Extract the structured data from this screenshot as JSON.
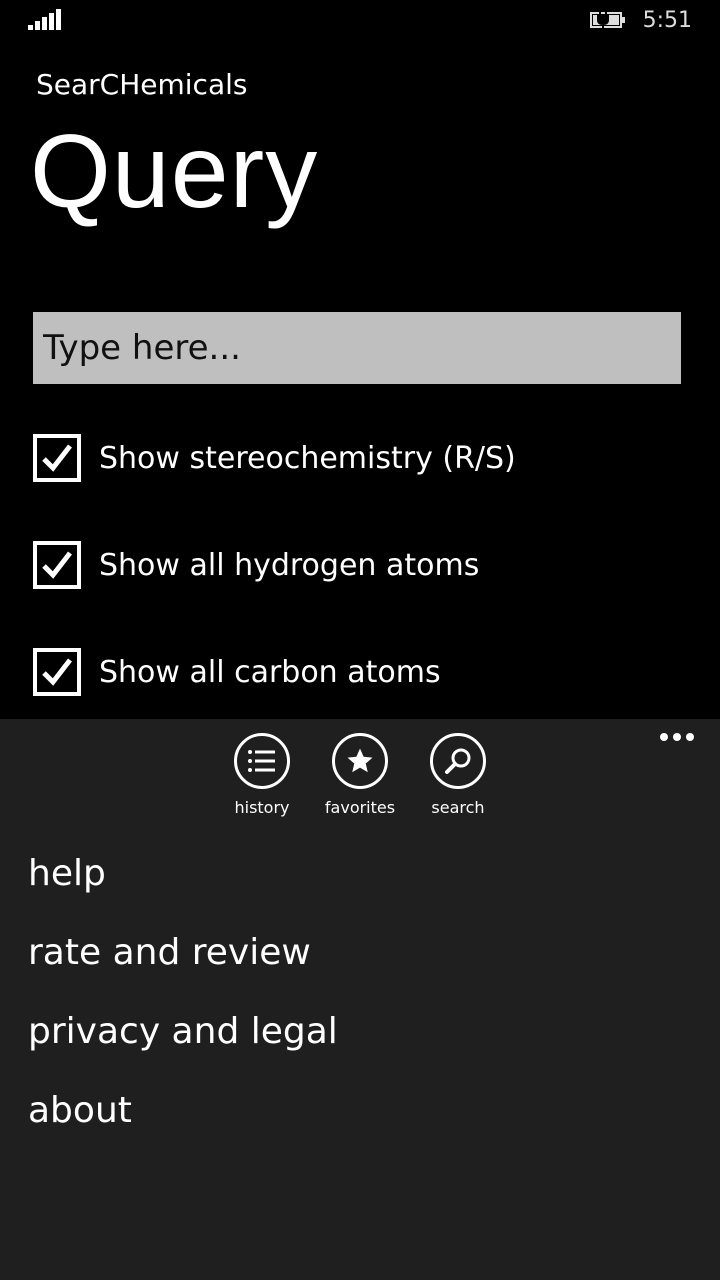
{
  "status_bar": {
    "time": "5:51",
    "signal_icon": "signal-bars-icon",
    "battery_icon": "battery-charging-icon"
  },
  "app": {
    "name": "SearCHemicals",
    "page_title": "Query"
  },
  "search": {
    "placeholder": "Type here...",
    "value": ""
  },
  "options": [
    {
      "label": "Show stereochemistry (R/S)",
      "checked": true
    },
    {
      "label": "Show all hydrogen atoms",
      "checked": true
    },
    {
      "label": "Show all carbon atoms",
      "checked": true
    }
  ],
  "app_bar": {
    "buttons": [
      {
        "label": "history",
        "icon": "history-list-icon"
      },
      {
        "label": "favorites",
        "icon": "star-icon"
      },
      {
        "label": "search",
        "icon": "search-icon"
      }
    ],
    "menu": [
      "help",
      "rate and review",
      "privacy and legal",
      "about"
    ]
  }
}
